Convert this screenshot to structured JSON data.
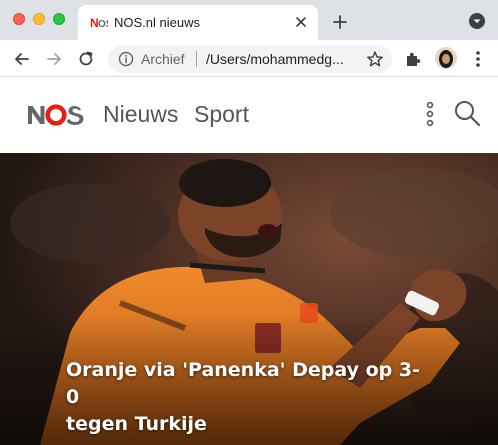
{
  "browser": {
    "tab": {
      "title": "NOS.nl nieuws",
      "favicon": "nos-favicon-icon"
    },
    "omnibox": {
      "label": "Archief",
      "url": "/Users/mohammedg..."
    }
  },
  "site": {
    "logo": "NOS",
    "nav": [
      {
        "label": "Nieuws"
      },
      {
        "label": "Sport"
      }
    ]
  },
  "hero": {
    "headline_line1": "Oranje via 'Panenka' Depay op 3-0",
    "headline_line2": "tegen Turkije"
  },
  "colors": {
    "nos_red": "#e61e14",
    "nos_grey": "#666666",
    "jersey_orange": "#e87d24"
  }
}
